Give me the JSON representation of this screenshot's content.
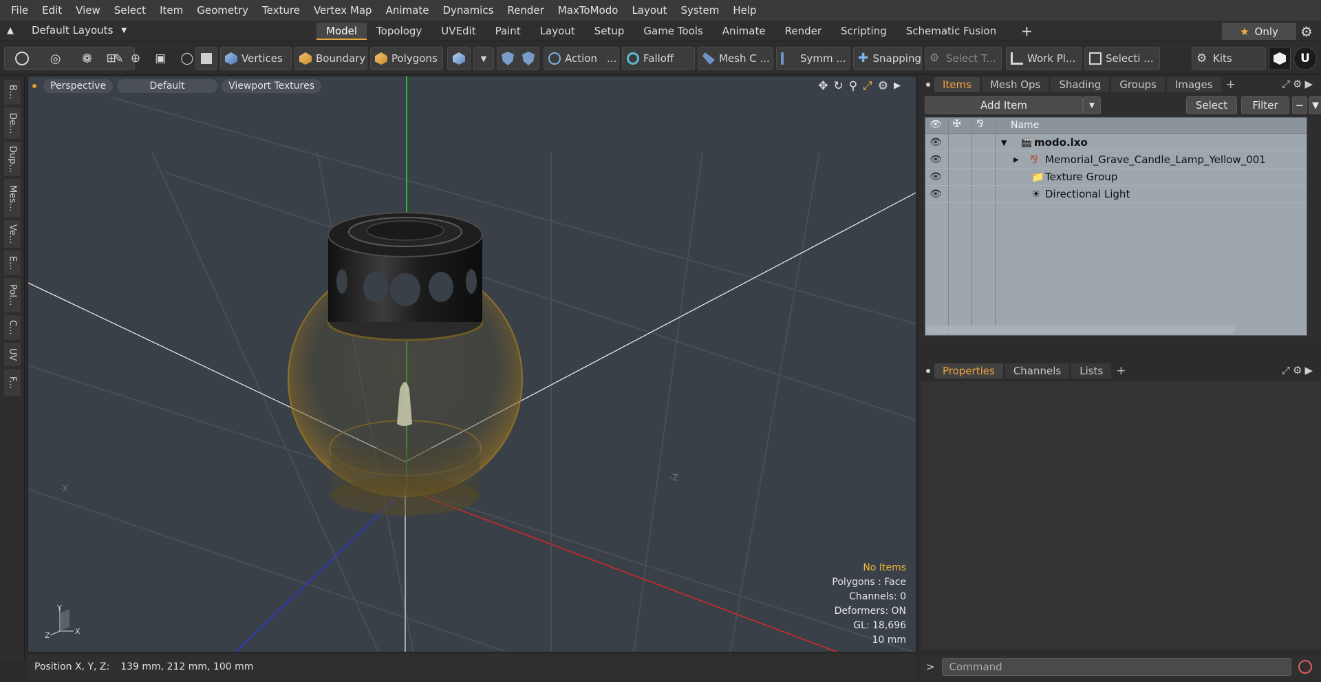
{
  "menu": [
    "File",
    "Edit",
    "View",
    "Select",
    "Item",
    "Geometry",
    "Texture",
    "Vertex Map",
    "Animate",
    "Dynamics",
    "Render",
    "MaxToModo",
    "Layout",
    "System",
    "Help"
  ],
  "layouts_label": "Default Layouts",
  "tabs": [
    "Model",
    "Topology",
    "UVEdit",
    "Paint",
    "Layout",
    "Setup",
    "Game Tools",
    "Animate",
    "Render",
    "Scripting",
    "Schematic Fusion"
  ],
  "only_label": "Only",
  "toolbar": {
    "vertices": "Vertices",
    "boundary": "Boundary",
    "polygons": "Polygons",
    "action": "Action",
    "falloff": "Falloff",
    "mesh": "Mesh C ...",
    "symm": "Symm ...",
    "snapping": "Snapping",
    "select_t": "Select T...",
    "work_pl": "Work Pl...",
    "selecti": "Selecti ...",
    "kits": "Kits"
  },
  "left_tabs": [
    "B...",
    "De...",
    "Dup...",
    "Mes...",
    "Ve...",
    "E...",
    "Pol...",
    "C...",
    "UV",
    "F..."
  ],
  "viewport": {
    "view": "Perspective",
    "shading": "Default",
    "textures": "Viewport Textures",
    "info": {
      "no_items": "No Items",
      "polygons": "Polygons : Face",
      "channels": "Channels: 0",
      "deformers": "Deformers: ON",
      "gl": "GL: 18,696",
      "scale": "10 mm"
    },
    "axis_x": "-X",
    "axis_z": "-Z",
    "gizmo": {
      "y": "Y",
      "z": "Z",
      "x": "X"
    }
  },
  "status": {
    "label": "Position X, Y, Z:",
    "value": "139 mm, 212 mm, 100 mm"
  },
  "items_panel": {
    "tabs": [
      "Items",
      "Mesh Ops",
      "Shading",
      "Groups",
      "Images"
    ],
    "add_item": "Add Item",
    "select": "Select",
    "filter": "Filter",
    "header_name": "Name",
    "rows": [
      {
        "name": "modo.lxo"
      },
      {
        "name": "Memorial_Grave_Candle_Lamp_Yellow_001"
      },
      {
        "name": "Texture Group"
      },
      {
        "name": "Directional Light"
      }
    ]
  },
  "props_panel": {
    "tabs": [
      "Properties",
      "Channels",
      "Lists"
    ]
  },
  "command": {
    "placeholder": "Command",
    "prompt": ">"
  },
  "colors": {
    "accent": "#f2a53a",
    "viewport_bg": "#3a4048",
    "axis_x": "#d02a2a",
    "axis_y": "#2bd62b",
    "axis_z": "#2a3ad8"
  }
}
